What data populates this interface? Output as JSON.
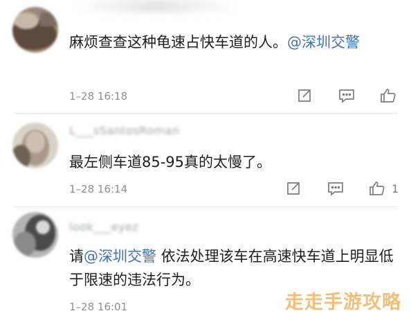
{
  "comments": [
    {
      "username": "",
      "text_plain": "麻烦查查这种龟速占快车道的人。",
      "mention": "@深圳交警",
      "text_after": "",
      "timestamp": "1–28 16:18",
      "likes": ""
    },
    {
      "username": "L___sSantosRoman",
      "text_plain": "最左侧车道85-95真的太慢了。",
      "mention": "",
      "text_after": "",
      "timestamp": "1–28 16:14",
      "likes": "1"
    },
    {
      "username": "look___eyez",
      "text_plain": "请",
      "mention": "@深圳交警",
      "text_after": " 依法处理该车在高速快车道上明显低于限速的违法行为。",
      "timestamp": "1–28 16:01",
      "likes": ""
    }
  ],
  "icons": {
    "repost": "repost-icon",
    "comment": "comment-icon",
    "like": "thumbs-up-icon"
  },
  "colors": {
    "mention": "#3f73b8",
    "meta": "#8f8f8f",
    "watermark": "#f2b45c"
  },
  "watermark": "走走手游攻略"
}
